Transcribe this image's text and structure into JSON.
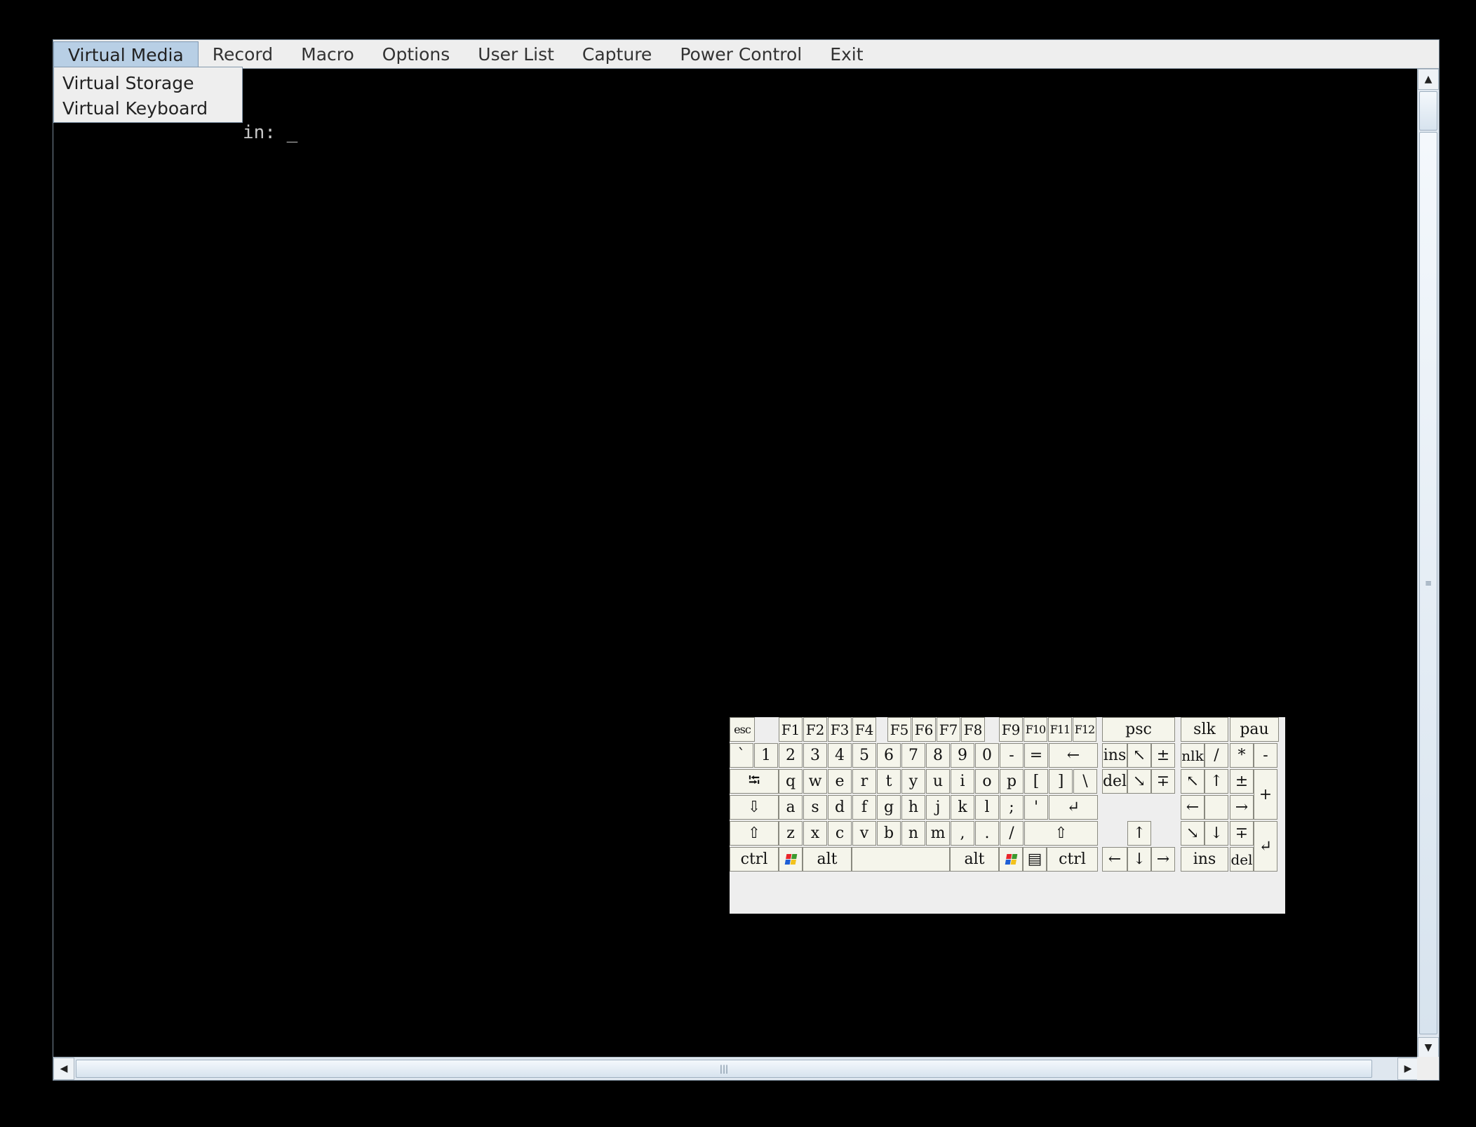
{
  "menubar": {
    "items": [
      {
        "name": "virtual-media",
        "label": "Virtual Media",
        "open": true
      },
      {
        "name": "record",
        "label": "Record"
      },
      {
        "name": "macro",
        "label": "Macro"
      },
      {
        "name": "options",
        "label": "Options"
      },
      {
        "name": "user-list",
        "label": "User List"
      },
      {
        "name": "capture",
        "label": "Capture"
      },
      {
        "name": "power-control",
        "label": "Power Control"
      },
      {
        "name": "exit",
        "label": "Exit"
      }
    ]
  },
  "dropdown": {
    "items": [
      {
        "name": "virtual-storage",
        "label": "Virtual Storage"
      },
      {
        "name": "virtual-keyboard",
        "label": "Virtual Keyboard"
      }
    ]
  },
  "console": {
    "visible_text": "in: ",
    "cursor": "_"
  },
  "scrollbars": {
    "up_icon": "triangle-up",
    "down_icon": "triangle-down",
    "left_icon": "triangle-left",
    "right_icon": "triangle-right",
    "grip": "≡",
    "hgrip": "|||"
  },
  "keyboard": {
    "row_fn": [
      "esc",
      "F1",
      "F2",
      "F3",
      "F4",
      "F5",
      "F6",
      "F7",
      "F8",
      "F9",
      "F10",
      "F11",
      "F12",
      "psc",
      "slk",
      "pau"
    ],
    "row_num": [
      "`",
      "1",
      "2",
      "3",
      "4",
      "5",
      "6",
      "7",
      "8",
      "9",
      "0",
      "-",
      "=",
      "←"
    ],
    "row_q": [
      "⭾",
      "q",
      "w",
      "e",
      "r",
      "t",
      "y",
      "u",
      "i",
      "o",
      "p",
      "[",
      "]",
      "\\"
    ],
    "row_a": [
      "⇩",
      "a",
      "s",
      "d",
      "f",
      "g",
      "h",
      "j",
      "k",
      "l",
      ";",
      "'",
      "↵"
    ],
    "row_z": [
      "⇧",
      "z",
      "x",
      "c",
      "v",
      "b",
      "n",
      "m",
      ",",
      ".",
      "/",
      "⇧"
    ],
    "row_ctrl": [
      "ctrl",
      "win",
      "alt",
      "",
      "alt",
      "win",
      "menu",
      "ctrl"
    ],
    "nav": [
      "ins",
      "↖",
      "±",
      "del",
      "↘",
      "∓",
      "↑",
      "←",
      "↓",
      "→"
    ],
    "numpad": [
      "nlk",
      "/",
      "*",
      "-",
      "↖",
      "↑",
      "±",
      "+",
      "←",
      "",
      "→",
      "↘",
      "↓",
      "∓",
      "↵",
      "ins",
      "del"
    ],
    "accent_colors": [
      "#e8262b",
      "#3b9a2e",
      "#1f5fd6",
      "#f2c21b"
    ]
  }
}
